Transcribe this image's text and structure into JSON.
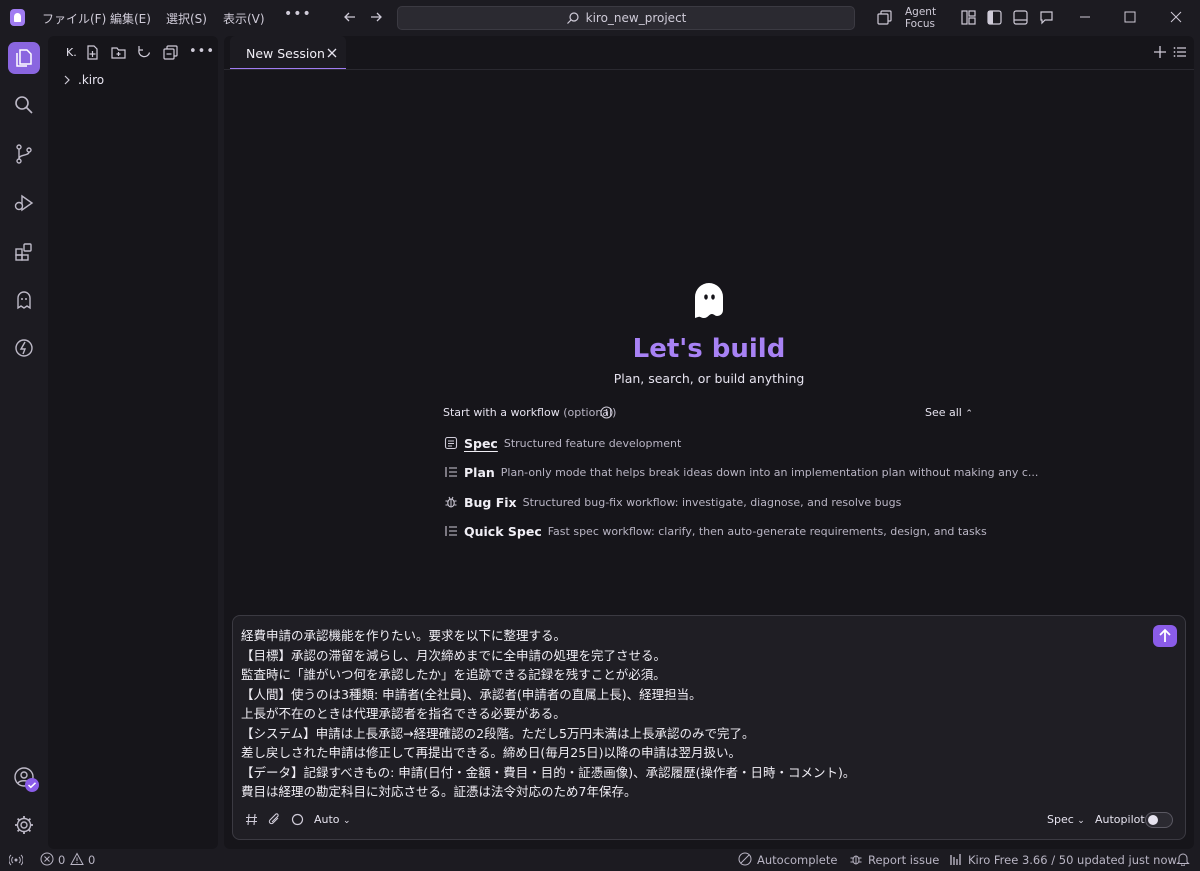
{
  "titlebar": {
    "menus": [
      "ファイル(F)",
      "編集(E)",
      "選択(S)",
      "表示(V)"
    ],
    "more": "•••",
    "search_text": "kiro_new_project",
    "agent_focus_line1": "Agent",
    "agent_focus_line2": "Focus"
  },
  "explorer": {
    "title": "K.",
    "tree": [
      ".kiro"
    ]
  },
  "tabs": {
    "active": "New Session"
  },
  "hero": {
    "title": "Let's build",
    "subtitle": "Plan, search, or build anything"
  },
  "workflow": {
    "start_label": "Start with a workflow",
    "optional": "(optional)",
    "see_all": "See all",
    "items": [
      {
        "name": "Spec",
        "desc": "Structured feature development",
        "icon": "document-icon"
      },
      {
        "name": "Plan",
        "desc": "Plan-only mode that helps break ideas down into an implementation plan without making any c...",
        "icon": "list-icon"
      },
      {
        "name": "Bug Fix",
        "desc": "Structured bug-fix workflow: investigate, diagnose, and resolve bugs",
        "icon": "bug-icon"
      },
      {
        "name": "Quick Spec",
        "desc": "Fast spec workflow: clarify, then auto-generate requirements, design, and tasks",
        "icon": "list-icon"
      }
    ]
  },
  "prompt": {
    "lines": [
      "経費申請の承認機能を作りたい。要求を以下に整理する。",
      "【目標】承認の滞留を減らし、月次締めまでに全申請の処理を完了させる。",
      "監査時に「誰がいつ何を承認したか」を追跡できる記録を残すことが必須。",
      "【人間】使うのは3種類: 申請者(全社員)、承認者(申請者の直属上長)、経理担当。",
      "上長が不在のときは代理承認者を指名できる必要がある。",
      "【システム】申請は上長承認→経理確認の2段階。ただし5万円未満は上長承認のみで完了。",
      "差し戻しされた申請は修正して再提出できる。締め日(毎月25日)以降の申請は翌月扱い。",
      "【データ】記録すべきもの: 申請(日付・金額・費目・目的・証憑画像)、承認履歴(操作者・日時・コメント)。",
      "費目は経理の勘定科目に対応させる。証憑は法令対応のため7年保存。"
    ],
    "mode": "Auto",
    "spec_select": "Spec",
    "autopilot_label": "Autopilot",
    "autopilot_on": false
  },
  "statusbar": {
    "errors": "0",
    "warnings": "0",
    "autocomplete": "Autocomplete",
    "report_issue": "Report issue",
    "plan": "Kiro Free 3.66 / 50 updated just now"
  },
  "colors": {
    "accent": "#a882f5",
    "accent_button": "#8a5ce8",
    "background": "#1c1b21",
    "panel": "#16151a"
  }
}
